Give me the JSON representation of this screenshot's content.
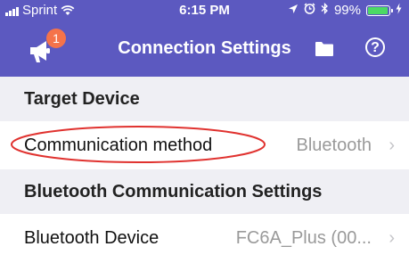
{
  "status_bar": {
    "carrier": "Sprint",
    "time": "6:15 PM",
    "battery_percent": "99%",
    "battery_level": 0.99,
    "icons": [
      "signal-icon",
      "wifi-icon",
      "location-icon",
      "alarm-icon",
      "bluetooth-icon",
      "battery-icon",
      "charging-icon"
    ]
  },
  "nav": {
    "title": "Connection Settings",
    "notification_count": "1",
    "left_icon": "megaphone-icon",
    "right_icons": [
      "folder-icon",
      "help-icon"
    ],
    "help_glyph": "?"
  },
  "sections": [
    {
      "header": "Target Device",
      "rows": [
        {
          "label": "Communication method",
          "value": "Bluetooth",
          "annotated": true
        }
      ]
    },
    {
      "header": "Bluetooth Communication Settings",
      "rows": [
        {
          "label": "Bluetooth Device",
          "value": "FC6A_Plus (00..."
        }
      ]
    }
  ],
  "colors": {
    "header_bg": "#5c59c0",
    "section_bg": "#efeff4",
    "annotation": "#e0322f",
    "badge": "#f5734a",
    "battery_fill": "#4cd964"
  }
}
